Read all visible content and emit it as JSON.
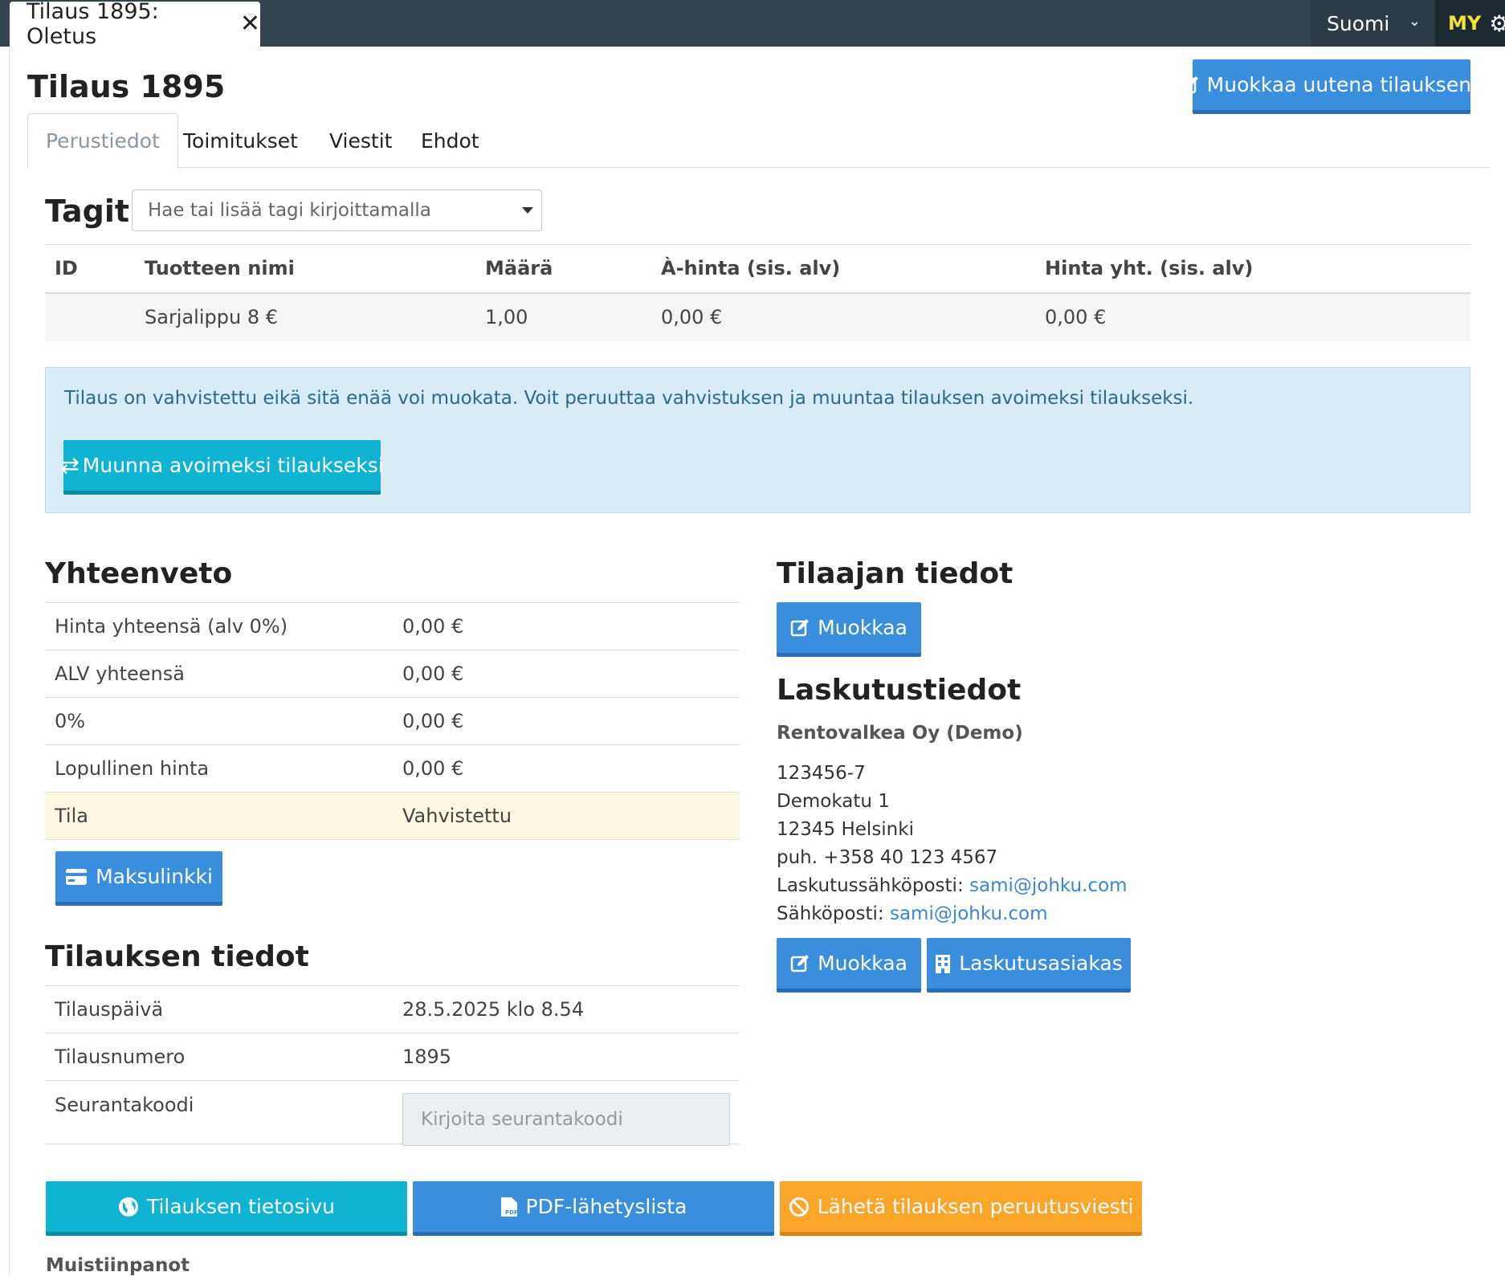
{
  "topbar": {
    "doc_tab_title": "Tilaus 1895: Oletus",
    "close_icon": "close-icon",
    "language": "Suomi",
    "user_initials": "MY",
    "settings_icon": "gear-icon"
  },
  "header": {
    "title": "Tilaus 1895",
    "edit_as_new_label": "Muokkaa uutena tilauksena"
  },
  "tabs": [
    {
      "label": "Perustiedot",
      "active": true
    },
    {
      "label": "Toimitukset",
      "active": false
    },
    {
      "label": "Viestit",
      "active": false
    },
    {
      "label": "Ehdot",
      "active": false
    }
  ],
  "tags": {
    "label": "Tagit",
    "placeholder": "Hae tai lisää tagi kirjoittamalla"
  },
  "products": {
    "columns": [
      "ID",
      "Tuotteen nimi",
      "Määrä",
      "À-hinta (sis. alv)",
      "Hinta yht. (sis. alv)"
    ],
    "rows": [
      {
        "id": "",
        "name": "Sarjalippu 8 €",
        "qty": "1,00",
        "unit_price": "0,00 €",
        "total": "0,00 €"
      }
    ]
  },
  "alert": {
    "text": "Tilaus on vahvistettu eikä sitä enää voi muokata. Voit peruuttaa vahvistuksen ja muuntaa tilauksen avoimeksi tilaukseksi.",
    "button_label": "Muunna avoimeksi tilaukseksi"
  },
  "summary": {
    "title": "Yhteenveto",
    "rows": [
      {
        "label": "Hinta yhteensä (alv 0%)",
        "value": "0,00 €"
      },
      {
        "label": "ALV yhteensä",
        "value": "0,00 €"
      },
      {
        "label": "0%",
        "value": "0,00 €"
      },
      {
        "label": "Lopullinen hinta",
        "value": "0,00 €"
      },
      {
        "label": "Tila",
        "value": "Vahvistettu"
      }
    ],
    "payment_link_label": "Maksulinkki"
  },
  "order_info": {
    "title": "Tilauksen tiedot",
    "rows": [
      {
        "label": "Tilauspäivä",
        "value": "28.5.2025 klo 8.54"
      },
      {
        "label": "Tilausnumero",
        "value": "1895"
      },
      {
        "label": "Seurantakoodi",
        "value": ""
      }
    ],
    "tracking_placeholder": "Kirjoita seurantakoodi"
  },
  "customer": {
    "title": "Tilaajan tiedot",
    "edit_label": "Muokkaa"
  },
  "billing": {
    "title": "Laskutustiedot",
    "company": "Rentovalkea Oy (Demo)",
    "business_id": "123456-7",
    "street": "Demokatu 1",
    "city": "12345 Helsinki",
    "phone": "puh. +358 40 123 4567",
    "billing_email_label": "Laskutussähköposti: ",
    "billing_email": "sami@johku.com",
    "email_label": "Sähköposti: ",
    "email": "sami@johku.com",
    "edit_label": "Muokkaa",
    "billing_customer_label": "Laskutusasiakas"
  },
  "actions": {
    "info_page_label": "Tilauksen tietosivu",
    "pdf_label": "PDF-lähetyslista",
    "cancel_label": "Lähetä tilauksen peruutusviesti"
  },
  "notes": {
    "title": "Muistiinpanot"
  }
}
